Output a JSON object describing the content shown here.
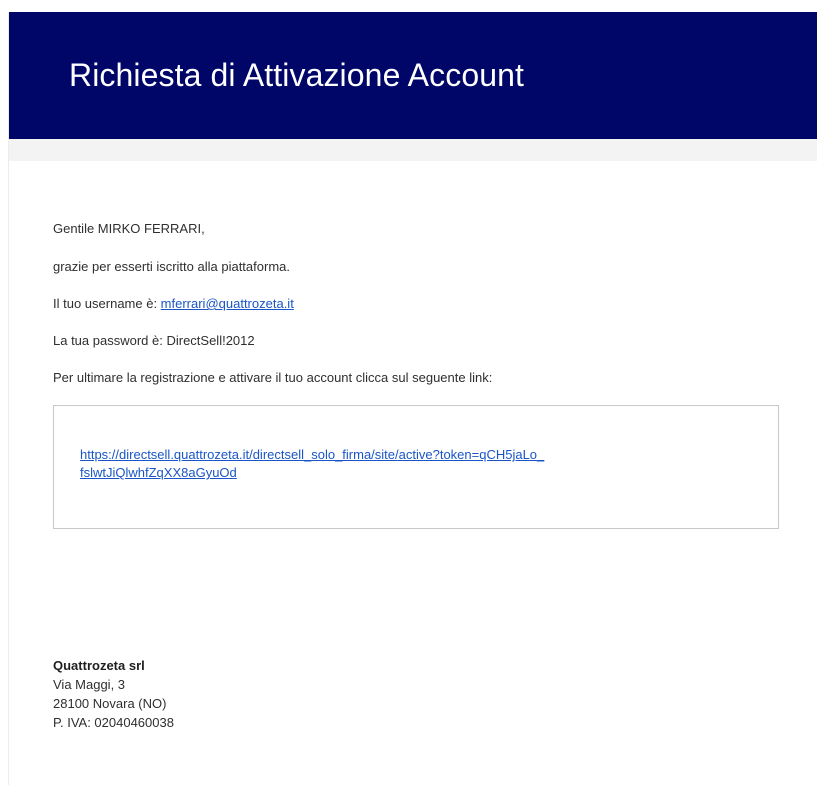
{
  "header": {
    "title": "Richiesta di Attivazione Account"
  },
  "message": {
    "greeting": "Gentile MIRKO FERRARI,",
    "thanks": "grazie per esserti iscritto alla piattaforma.",
    "username_label": "Il tuo username è: ",
    "username_value": "mferrari@quattrozeta.it",
    "password_line": "La tua password è: DirectSell!2012",
    "instructions": "Per ultimare la registrazione e attivare il tuo account clicca sul seguente link:",
    "activation_link_line1": "https://directsell.quattrozeta.it/directsell_solo_firma/site/active?token=qCH5jaLo_",
    "activation_link_line2": "fslwtJiQlwhfZqXX8aGyuOd"
  },
  "footer": {
    "company": "Quattrozeta srl",
    "address": "Via Maggi, 3",
    "city": "28100 Novara (NO)",
    "vat": "P. IVA: 02040460038"
  },
  "colors": {
    "header_background": "#000568",
    "link": "#1a55c7"
  }
}
